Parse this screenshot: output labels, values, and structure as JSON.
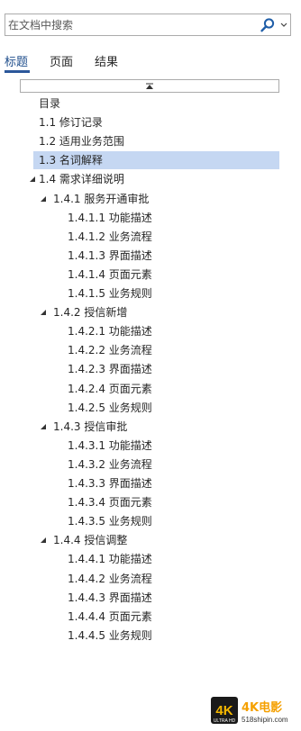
{
  "search": {
    "placeholder": "在文档中搜索",
    "search_icon": "search-icon",
    "dropdown_icon": "chevron-down-icon"
  },
  "tabs": [
    {
      "label": "标题",
      "active": true
    },
    {
      "label": "页面",
      "active": false
    },
    {
      "label": "结果",
      "active": false
    }
  ],
  "collapse_icon": "collapse-up-icon",
  "headings": [
    {
      "label": "目录",
      "level": 1,
      "expander": null,
      "selected": false
    },
    {
      "label": "1.1 修订记录",
      "level": 1,
      "expander": null,
      "selected": false
    },
    {
      "label": "1.2 适用业务范围",
      "level": 1,
      "expander": null,
      "selected": false
    },
    {
      "label": "1.3 名词解释",
      "level": 1,
      "expander": null,
      "selected": true
    },
    {
      "label": "1.4 需求详细说明",
      "level": 1,
      "expander": "expanded",
      "selected": false
    },
    {
      "label": "1.4.1 服务开通审批",
      "level": 2,
      "expander": "expanded",
      "selected": false
    },
    {
      "label": "1.4.1.1 功能描述",
      "level": 3,
      "expander": null,
      "selected": false
    },
    {
      "label": "1.4.1.2 业务流程",
      "level": 3,
      "expander": null,
      "selected": false
    },
    {
      "label": "1.4.1.3 界面描述",
      "level": 3,
      "expander": null,
      "selected": false
    },
    {
      "label": "1.4.1.4 页面元素",
      "level": 3,
      "expander": null,
      "selected": false
    },
    {
      "label": "1.4.1.5 业务规则",
      "level": 3,
      "expander": null,
      "selected": false
    },
    {
      "label": "1.4.2 授信新增",
      "level": 2,
      "expander": "expanded",
      "selected": false
    },
    {
      "label": "1.4.2.1 功能描述",
      "level": 3,
      "expander": null,
      "selected": false
    },
    {
      "label": "1.4.2.2 业务流程",
      "level": 3,
      "expander": null,
      "selected": false
    },
    {
      "label": "1.4.2.3 界面描述",
      "level": 3,
      "expander": null,
      "selected": false
    },
    {
      "label": "1.4.2.4 页面元素",
      "level": 3,
      "expander": null,
      "selected": false
    },
    {
      "label": "1.4.2.5 业务规则",
      "level": 3,
      "expander": null,
      "selected": false
    },
    {
      "label": "1.4.3 授信审批",
      "level": 2,
      "expander": "expanded",
      "selected": false
    },
    {
      "label": "1.4.3.1 功能描述",
      "level": 3,
      "expander": null,
      "selected": false
    },
    {
      "label": "1.4.3.2 业务流程",
      "level": 3,
      "expander": null,
      "selected": false
    },
    {
      "label": "1.4.3.3 界面描述",
      "level": 3,
      "expander": null,
      "selected": false
    },
    {
      "label": "1.4.3.4 页面元素",
      "level": 3,
      "expander": null,
      "selected": false
    },
    {
      "label": "1.4.3.5 业务规则",
      "level": 3,
      "expander": null,
      "selected": false
    },
    {
      "label": "1.4.4 授信调整",
      "level": 2,
      "expander": "expanded",
      "selected": false
    },
    {
      "label": "1.4.4.1 功能描述",
      "level": 3,
      "expander": null,
      "selected": false
    },
    {
      "label": "1.4.4.2 业务流程",
      "level": 3,
      "expander": null,
      "selected": false
    },
    {
      "label": "1.4.4.3 界面描述",
      "level": 3,
      "expander": null,
      "selected": false
    },
    {
      "label": "1.4.4.4 页面元素",
      "level": 3,
      "expander": null,
      "selected": false
    },
    {
      "label": "1.4.4.5 业务规则",
      "level": 3,
      "expander": null,
      "selected": false
    }
  ],
  "watermark": {
    "logo_text": "4K",
    "sub_text": "ULTRA HD",
    "brand": "4K电影",
    "url": "518shipin.com"
  },
  "colors": {
    "accent": "#2b579a",
    "selected_bg": "#c5d7f2",
    "search_icon": "#1f5ea8"
  }
}
